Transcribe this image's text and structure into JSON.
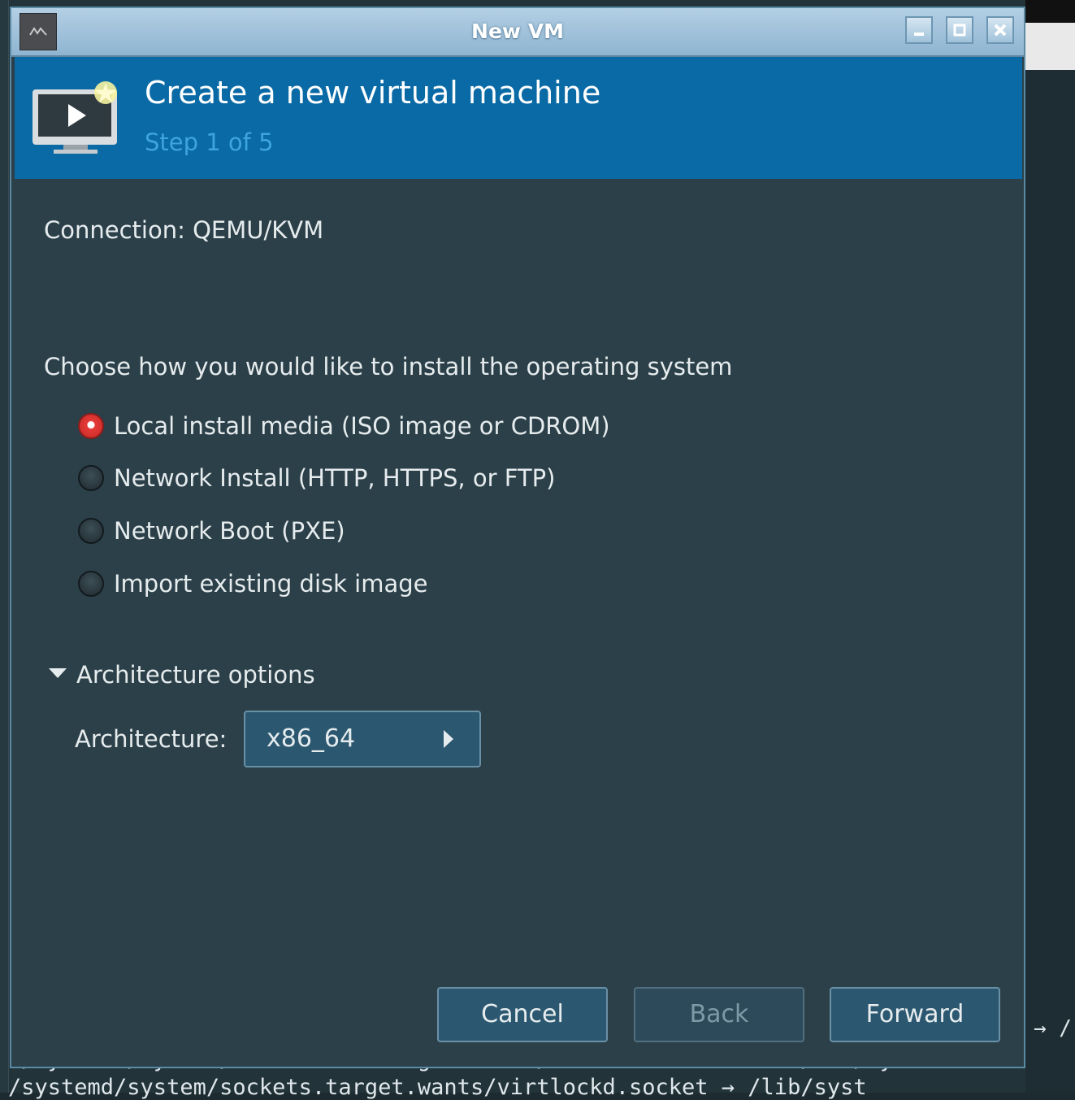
{
  "window": {
    "title": "New VM",
    "app_icon": "virt-manager-logo-icon",
    "controls": {
      "minimize": "minimize-icon",
      "maximize": "maximize-icon",
      "close": "close-icon"
    }
  },
  "header": {
    "title": "Create a new virtual machine",
    "step": "Step 1 of 5",
    "icon": "new-vm-monitor-icon"
  },
  "connection": {
    "text": "Connection:  QEMU/KVM"
  },
  "install": {
    "prompt": "Choose how you would like to install the operating system",
    "options": [
      {
        "label": "Local install media (ISO image or CDROM)",
        "checked": true
      },
      {
        "label": "Network Install (HTTP, HTTPS, or FTP)",
        "checked": false
      },
      {
        "label": "Network Boot (PXE)",
        "checked": false
      },
      {
        "label": "Import existing disk image",
        "checked": false
      }
    ]
  },
  "architecture": {
    "expander_label": "Architecture options",
    "expanded": true,
    "label": "Architecture:",
    "value": "x86_64"
  },
  "buttons": {
    "cancel": "Cancel",
    "back": "Back",
    "forward": "Forward",
    "back_enabled": false
  },
  "terminal": {
    "arrow": "→ /",
    "line1": "r/systemd/system/multi-user.target.wants/libvirtd.service → /lib/sy",
    "line2": "/systemd/system/sockets.target.wants/virtlockd.socket → /lib/syst"
  },
  "colors": {
    "header_bg": "#0a6aa6",
    "dialog_bg": "#2c4049",
    "step_text": "#3da4dc",
    "radio_checked": "#e53a36",
    "titlebar": "#9fc2da"
  }
}
